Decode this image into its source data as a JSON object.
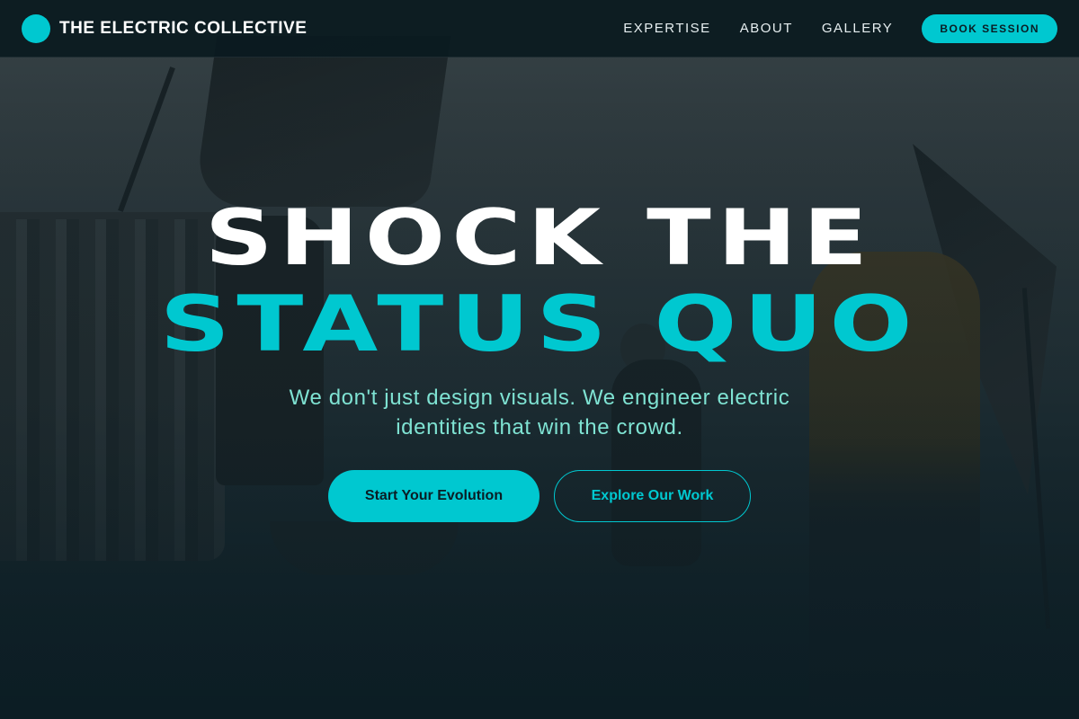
{
  "nav": {
    "brand_name": "THE ELECTRIC COLLECTIVE",
    "links": [
      "EXPERTISE",
      "ABOUT",
      "GALLERY"
    ],
    "cta_label": "BOOK SESSION"
  },
  "hero": {
    "headline_line1": "SHOCK THE",
    "headline_line2": "STATUS QUO",
    "subtitle": "We don't just design visuals. We engineer electric identities that win the crowd.",
    "primary_button": "Start Your Evolution",
    "secondary_button": "Explore Our Work"
  },
  "colors": {
    "accent": "#00c8d0",
    "subtitle": "#7fe3d3",
    "nav_background": "#0a1a20",
    "headline_primary": "#ffffff"
  },
  "icons": {
    "brand_mark": "circle-logo-icon"
  }
}
